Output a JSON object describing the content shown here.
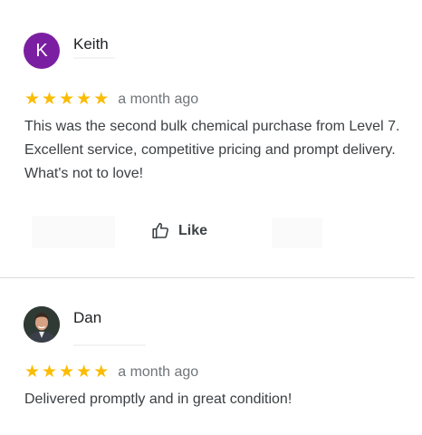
{
  "reviews": [
    {
      "author": "Keith",
      "avatar_initial": "K",
      "avatar_color": "#7b1fa2",
      "rating": 5,
      "stars": [
        "★",
        "★",
        "★",
        "★",
        "★"
      ],
      "date": "a month ago",
      "text": "This was the second bulk chemical purchase from Level 7. Excellent service, competitive pricing and prompt delivery. What's not to love!",
      "like_label": "Like"
    },
    {
      "author": "Dan",
      "avatar_initial": "",
      "rating": 5,
      "stars": [
        "★",
        "★",
        "★",
        "★",
        "★"
      ],
      "date": "a month ago",
      "text": "Delivered promptly and in great condition!"
    }
  ],
  "colors": {
    "star": "#fbbc04",
    "divider": "#dadce0",
    "text": "#3c4043",
    "meta": "#70757a"
  },
  "icons": {
    "like": "thumbs-up-icon"
  }
}
